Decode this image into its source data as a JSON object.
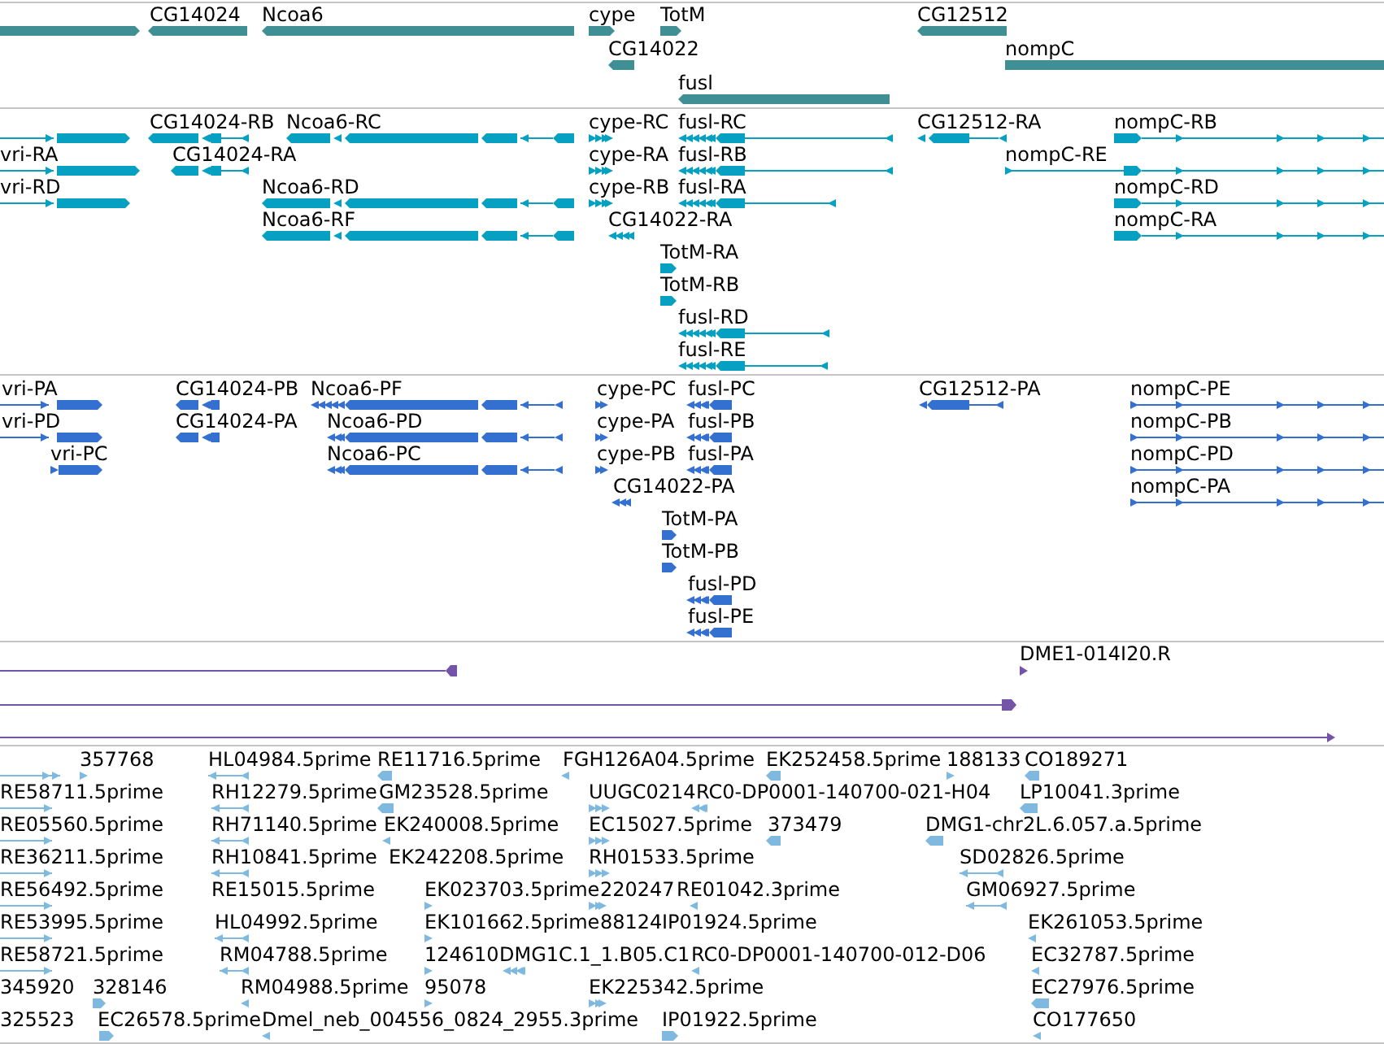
{
  "tracks": [
    {
      "color": "#408f95",
      "features": [
        {
          "label": "CG14024"
        },
        {
          "label": "Ncoa6"
        },
        {
          "label": "cype"
        },
        {
          "label": "TotM"
        },
        {
          "label": "CG12512"
        },
        {
          "label": "CG14022"
        },
        {
          "label": "nompC"
        },
        {
          "label": "fusl"
        }
      ]
    },
    {
      "color": "#06a0c2",
      "features": [
        {
          "label": "CG14024-RB"
        },
        {
          "label": "Ncoa6-RC"
        },
        {
          "label": "cype-RC"
        },
        {
          "label": "fusl-RC"
        },
        {
          "label": "CG12512-RA"
        },
        {
          "label": "nompC-RB"
        },
        {
          "label": "vri-RA"
        },
        {
          "label": "CG14024-RA"
        },
        {
          "label": "cype-RA"
        },
        {
          "label": "fusl-RB"
        },
        {
          "label": "nompC-RE"
        },
        {
          "label": "vri-RD"
        },
        {
          "label": "Ncoa6-RD"
        },
        {
          "label": "cype-RB"
        },
        {
          "label": "fusl-RA"
        },
        {
          "label": "nompC-RD"
        },
        {
          "label": "Ncoa6-RF"
        },
        {
          "label": "CG14022-RA"
        },
        {
          "label": "nompC-RA"
        },
        {
          "label": "TotM-RA"
        },
        {
          "label": "TotM-RB"
        },
        {
          "label": "fusl-RD"
        },
        {
          "label": "fusl-RE"
        }
      ]
    },
    {
      "color": "#3370d0",
      "features": [
        {
          "label": "vri-PA"
        },
        {
          "label": "CG14024-PB"
        },
        {
          "label": "Ncoa6-PF"
        },
        {
          "label": "cype-PC"
        },
        {
          "label": "fusl-PC"
        },
        {
          "label": "CG12512-PA"
        },
        {
          "label": "nompC-PE"
        },
        {
          "label": "vri-PD"
        },
        {
          "label": "CG14024-PA"
        },
        {
          "label": "Ncoa6-PD"
        },
        {
          "label": "cype-PA"
        },
        {
          "label": "fusl-PB"
        },
        {
          "label": "nompC-PB"
        },
        {
          "label": "vri-PC"
        },
        {
          "label": "Ncoa6-PC"
        },
        {
          "label": "cype-PB"
        },
        {
          "label": "fusl-PA"
        },
        {
          "label": "nompC-PD"
        },
        {
          "label": "CG14022-PA"
        },
        {
          "label": "nompC-PA"
        },
        {
          "label": "TotM-PA"
        },
        {
          "label": "TotM-PB"
        },
        {
          "label": "fusl-PD"
        },
        {
          "label": "fusl-PE"
        }
      ]
    },
    {
      "color": "#7454a8",
      "features": [
        {
          "label": "DME1-014I20.R"
        }
      ]
    },
    {
      "color": "#80b9e0",
      "features": [
        {
          "label": "357768"
        },
        {
          "label": "HL04984.5prime"
        },
        {
          "label": "RE11716.5prime"
        },
        {
          "label": "FGH126A04.5prime"
        },
        {
          "label": "EK252458.5prime"
        },
        {
          "label": "188133"
        },
        {
          "label": "CO189271"
        },
        {
          "label": "RE58711.5prime"
        },
        {
          "label": "RH12279.5prime"
        },
        {
          "label": "GM23528.5prime"
        },
        {
          "label": "UUGC0214"
        },
        {
          "label": "RC0-DP0001-140700-021-H04"
        },
        {
          "label": "LP10041.3prime"
        },
        {
          "label": "RE05560.5prime"
        },
        {
          "label": "RH71140.5prime"
        },
        {
          "label": "EK240008.5prime"
        },
        {
          "label": "EC15027.5prime"
        },
        {
          "label": "373479"
        },
        {
          "label": "DMG1-chr2L.6.057.a.5prime"
        },
        {
          "label": "RE36211.5prime"
        },
        {
          "label": "RH10841.5prime"
        },
        {
          "label": "EK242208.5prime"
        },
        {
          "label": "RH01533.5prime"
        },
        {
          "label": "SD02826.5prime"
        },
        {
          "label": "RE56492.5prime"
        },
        {
          "label": "RE15015.5prime"
        },
        {
          "label": "EK023703.5prime"
        },
        {
          "label": "220247"
        },
        {
          "label": "RE01042.3prime"
        },
        {
          "label": "GM06927.5prime"
        },
        {
          "label": "RE53995.5prime"
        },
        {
          "label": "HL04992.5prime"
        },
        {
          "label": "EK101662.5prime"
        },
        {
          "label": "88124"
        },
        {
          "label": "IP01924.5prime"
        },
        {
          "label": "EK261053.5prime"
        },
        {
          "label": "RE58721.5prime"
        },
        {
          "label": "RM04788.5prime"
        },
        {
          "label": "124610"
        },
        {
          "label": "DMG1C.1_1.B05.C1"
        },
        {
          "label": "RC0-DP0001-140700-012-D06"
        },
        {
          "label": "EC32787.5prime"
        },
        {
          "label": "345920"
        },
        {
          "label": "328146"
        },
        {
          "label": "RM04988.5prime"
        },
        {
          "label": "95078"
        },
        {
          "label": "EK225342.5prime"
        },
        {
          "label": "EC27976.5prime"
        },
        {
          "label": "325523"
        },
        {
          "label": "EC26578.5prime"
        },
        {
          "label": "Dmel_neb_004556_0824_2955.3prime"
        },
        {
          "label": "IP01922.5prime"
        },
        {
          "label": "CO177650"
        }
      ]
    }
  ]
}
